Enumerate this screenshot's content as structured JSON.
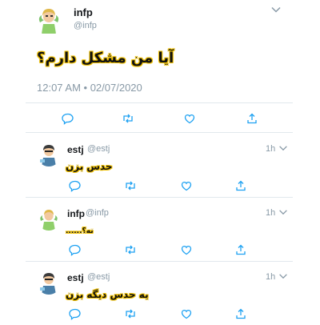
{
  "main_tweet": {
    "display_name": "infp",
    "handle": "@infp",
    "text": "آیا من مشکل دارم؟",
    "timestamp": "12:07 AM • 02/07/2020"
  },
  "replies": [
    {
      "display_name": "estj",
      "handle": "@estj",
      "time": "1h",
      "text": "حدس بزن"
    },
    {
      "display_name": "infp",
      "handle": "@infp",
      "time": "1h",
      "text": "نه؟......"
    },
    {
      "display_name": "estj",
      "handle": "@estj",
      "time": "1h",
      "text": "یه حدس دیگه بزن"
    }
  ],
  "icons": [
    "reply-icon",
    "retweet-icon",
    "like-icon",
    "share-icon",
    "chevron-down-icon"
  ],
  "colors": {
    "icon": "#1da1f2",
    "muted": "#8899a6",
    "highlight": "#f0c000",
    "divider": "#e1e8ed"
  }
}
